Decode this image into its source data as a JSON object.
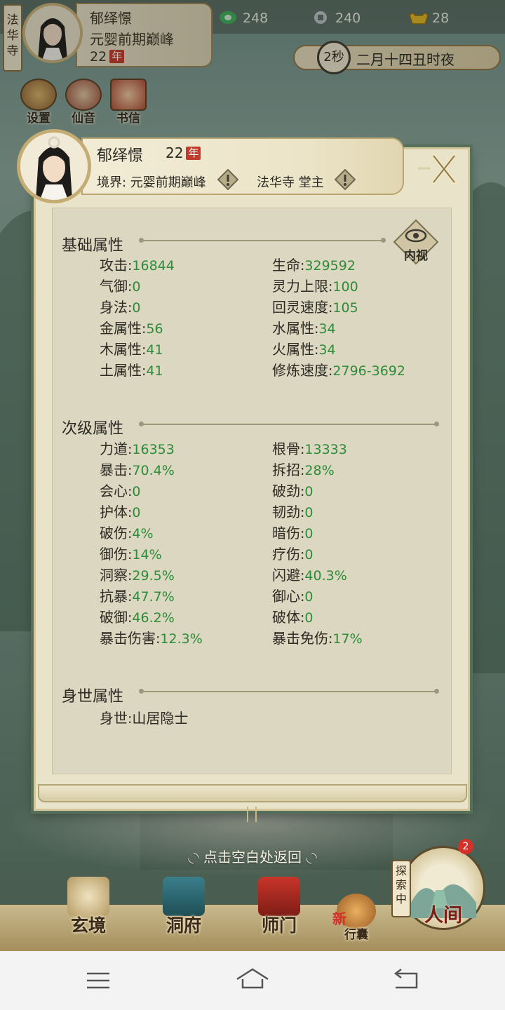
{
  "hud": {
    "sect_tag": "法华寺",
    "player_name": "郁绎憬",
    "player_realm": "元婴前期巅峰",
    "player_age": "22",
    "age_unit": "年",
    "resources": [
      {
        "icon": "spirit-stone-icon",
        "value": "248"
      },
      {
        "icon": "coin-icon",
        "value": "240"
      },
      {
        "icon": "ingot-icon",
        "value": "28"
      }
    ],
    "time_seconds": "2秒",
    "time_text": "二月十四丑时夜",
    "quick_buttons": [
      {
        "icon": "settings-icon",
        "label": "设置"
      },
      {
        "icon": "immortal-sound-icon",
        "label": "仙音"
      },
      {
        "icon": "letter-icon",
        "label": "书信"
      }
    ]
  },
  "panel": {
    "name": "郁绎憬",
    "age": "22",
    "age_unit": "年",
    "realm": "境界: 元婴前期巅峰",
    "post": "法华寺 堂主",
    "inner_view_label": "内视",
    "sections": {
      "basic": {
        "title": "基础属性",
        "attrs": [
          {
            "label": "攻击",
            "value": "16844"
          },
          {
            "label": "生命",
            "value": "329592"
          },
          {
            "label": "气御",
            "value": "0"
          },
          {
            "label": "灵力上限",
            "value": "100"
          },
          {
            "label": "身法",
            "value": "0"
          },
          {
            "label": "回灵速度",
            "value": "105"
          },
          {
            "label": "金属性",
            "value": "56"
          },
          {
            "label": "水属性",
            "value": "34"
          },
          {
            "label": "木属性",
            "value": "41"
          },
          {
            "label": "火属性",
            "value": "34"
          },
          {
            "label": "土属性",
            "value": "41"
          },
          {
            "label": "修炼速度",
            "value": "2796-3692"
          }
        ]
      },
      "secondary": {
        "title": "次级属性",
        "attrs": [
          {
            "label": "力道",
            "value": "16353"
          },
          {
            "label": "根骨",
            "value": "13333"
          },
          {
            "label": "暴击",
            "value": "70.4%"
          },
          {
            "label": "拆招",
            "value": "28%"
          },
          {
            "label": "会心",
            "value": "0"
          },
          {
            "label": "破劲",
            "value": "0"
          },
          {
            "label": "护体",
            "value": "0"
          },
          {
            "label": "韧劲",
            "value": "0"
          },
          {
            "label": "破伤",
            "value": "4%"
          },
          {
            "label": "暗伤",
            "value": "0"
          },
          {
            "label": "御伤",
            "value": "14%"
          },
          {
            "label": "疗伤",
            "value": "0"
          },
          {
            "label": "洞察",
            "value": "29.5%"
          },
          {
            "label": "闪避",
            "value": "40.3%"
          },
          {
            "label": "抗暴",
            "value": "47.7%"
          },
          {
            "label": "御心",
            "value": "0"
          },
          {
            "label": "破御",
            "value": "46.2%"
          },
          {
            "label": "破体",
            "value": "0"
          },
          {
            "label": "暴击伤害",
            "value": "12.3%"
          },
          {
            "label": "暴击免伤",
            "value": "17%"
          }
        ]
      },
      "background": {
        "title": "身世属性",
        "attrs": [
          {
            "label": "身世",
            "value": "山居隐士"
          }
        ]
      }
    },
    "separator": ":"
  },
  "hint": "点击空白处返回",
  "nav": {
    "items": [
      {
        "icon": "mystic-realm-icon",
        "label": "玄境"
      },
      {
        "icon": "cave-dwelling-icon",
        "label": "洞府"
      },
      {
        "icon": "sect-gate-icon",
        "label": "师门"
      },
      {
        "icon": "bag-icon",
        "label": "行囊"
      },
      {
        "icon": "world-icon",
        "label": "人间"
      }
    ],
    "bag_new_tag": "新",
    "exploring_tag": "探索中",
    "badge_count": "2"
  },
  "colors": {
    "value_green": "#2e8b3a",
    "age_red": "#c23a2a",
    "badge_red": "#d6302a"
  }
}
